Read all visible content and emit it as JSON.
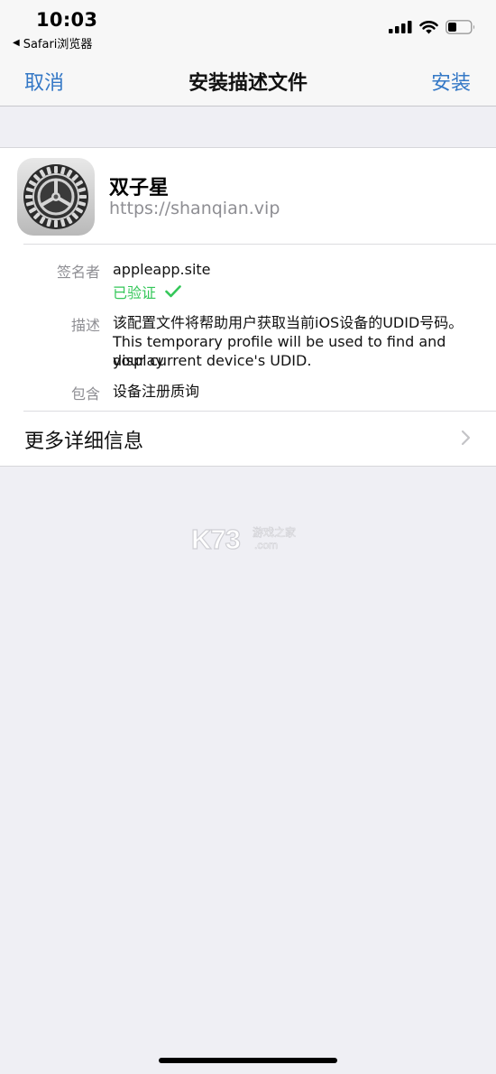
{
  "status_bar": {
    "time": "10:03",
    "back_app": "Safari浏览器",
    "back_icon": "back-triangle-icon",
    "battery_icon": "battery-icon",
    "wifi_icon": "wifi-icon",
    "signal_icon": "cellular-signal-icon"
  },
  "nav": {
    "cancel": "取消",
    "title": "安装描述文件",
    "install": "安装"
  },
  "profile": {
    "name": "双子星",
    "url": "https://shanqian.vip",
    "icon": "settings-gear-icon"
  },
  "details": {
    "signer_label": "签名者",
    "signer_value": "appleapp.site",
    "verified_text": "已验证",
    "verified_icon": "checkmark-icon",
    "description_label": "描述",
    "description_line1": "该配置文件将帮助用户获取当前iOS设备的UDID号码。",
    "description_line2": "This temporary profile will be used to find and display",
    "description_line3": "your current device's UDID.",
    "contains_label": "包含",
    "contains_value": "设备注册质询"
  },
  "more": {
    "label": "更多详细信息",
    "icon": "chevron-right-icon"
  },
  "watermark": {
    "brand": "K73",
    "tagline": "游戏之家",
    "domain": ".com"
  },
  "colors": {
    "accent": "#3478c6",
    "verified": "#34c759",
    "secondary_text": "#8e8e93",
    "background": "#efeff4"
  }
}
